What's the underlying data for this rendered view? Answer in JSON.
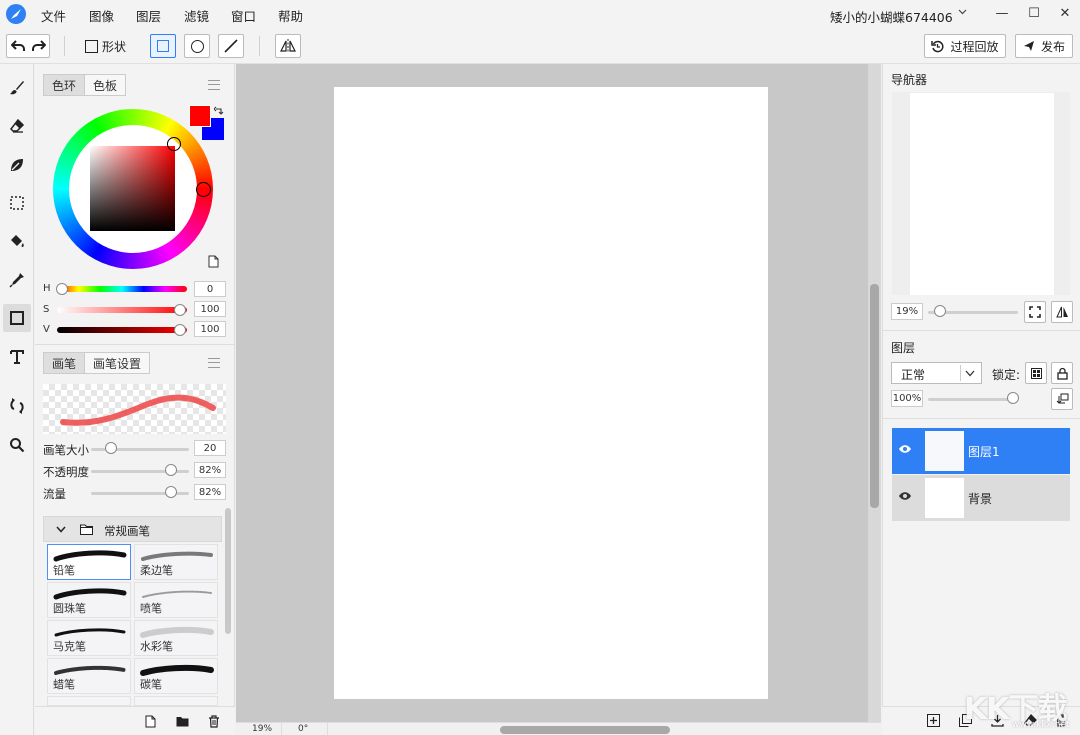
{
  "menu": [
    "文件",
    "图像",
    "图层",
    "滤镜",
    "窗口",
    "帮助"
  ],
  "user": {
    "name": "矮小的小蝴蝶674406"
  },
  "window_controls": {
    "minimize": "—",
    "maximize": "☐",
    "close": "✕"
  },
  "toolbar": {
    "shape_label": "形状",
    "history_label": "过程回放",
    "publish_label": "发布"
  },
  "color_panel": {
    "tabs": [
      "色环",
      "色板"
    ],
    "fg_color": "#ff0000",
    "bg_color": "#0000ff",
    "hsv": {
      "h_label": "H",
      "h_value": "0",
      "s_label": "S",
      "s_value": "100",
      "v_label": "V",
      "v_value": "100"
    }
  },
  "brush_panel": {
    "tabs": [
      "画笔",
      "画笔设置"
    ],
    "size_label": "画笔大小",
    "size_value": "20",
    "size_fraction": 0.2,
    "opacity_label": "不透明度",
    "opacity_value": "82%",
    "opacity_fraction": 0.82,
    "flow_label": "流量",
    "flow_value": "82%",
    "flow_fraction": 0.82,
    "group_name": "常规画笔",
    "brushes": [
      "铅笔",
      "柔边笔",
      "圆珠笔",
      "喷笔",
      "马克笔",
      "水彩笔",
      "蜡笔",
      "碳笔"
    ]
  },
  "status": {
    "zoom": "19%",
    "rotation": "0°"
  },
  "navigator": {
    "title": "导航器",
    "zoom": "19%"
  },
  "layers": {
    "title": "图层",
    "blend_mode": "正常",
    "lock_label": "锁定:",
    "opacity": "100%",
    "items": [
      {
        "name": "图层1",
        "selected": true
      },
      {
        "name": "背景",
        "selected": false
      }
    ]
  },
  "watermark": {
    "text": "KK下载",
    "url_text": "www.kkx.net"
  },
  "accent": "#2f7ff5"
}
